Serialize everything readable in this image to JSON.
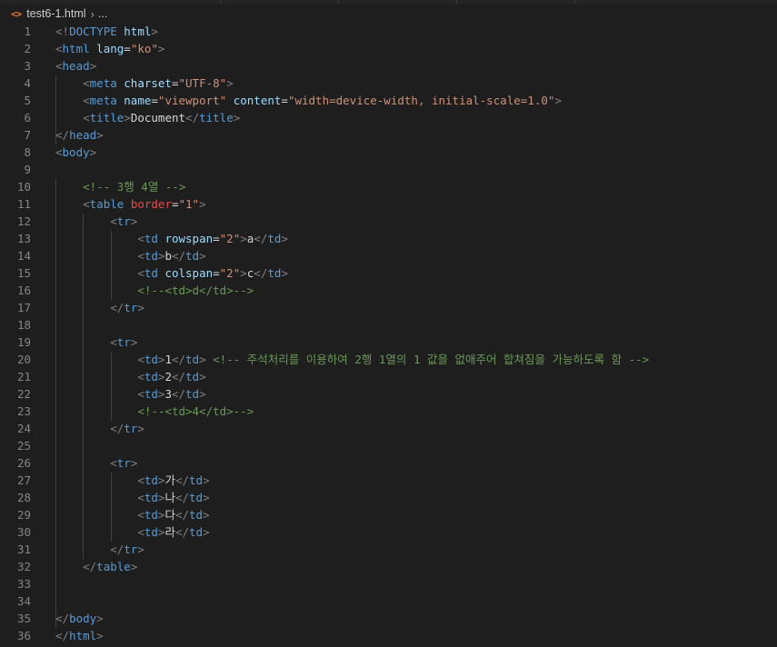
{
  "breadcrumb": {
    "file_icon": "<>",
    "filename": "test6-1.html",
    "ellipsis": "..."
  },
  "lines": [
    {
      "num": "1",
      "tokens": [
        [
          "b",
          "<!"
        ],
        [
          "tag",
          "DOCTYPE"
        ],
        [
          "text",
          " "
        ],
        [
          "attr",
          "html"
        ],
        [
          "b",
          ">"
        ]
      ]
    },
    {
      "num": "2",
      "tokens": [
        [
          "b",
          "<"
        ],
        [
          "tag",
          "html"
        ],
        [
          "text",
          " "
        ],
        [
          "attr",
          "lang"
        ],
        [
          "text",
          "="
        ],
        [
          "str",
          "\"ko\""
        ],
        [
          "b",
          ">"
        ]
      ]
    },
    {
      "num": "3",
      "tokens": [
        [
          "b",
          "<"
        ],
        [
          "tag",
          "head"
        ],
        [
          "b",
          ">"
        ]
      ]
    },
    {
      "num": "4",
      "tokens": [
        [
          "text",
          "    "
        ],
        [
          "b",
          "<"
        ],
        [
          "tag",
          "meta"
        ],
        [
          "text",
          " "
        ],
        [
          "attr",
          "charset"
        ],
        [
          "text",
          "="
        ],
        [
          "str",
          "\"UTF-8\""
        ],
        [
          "b",
          ">"
        ]
      ]
    },
    {
      "num": "5",
      "tokens": [
        [
          "text",
          "    "
        ],
        [
          "b",
          "<"
        ],
        [
          "tag",
          "meta"
        ],
        [
          "text",
          " "
        ],
        [
          "attr",
          "name"
        ],
        [
          "text",
          "="
        ],
        [
          "str",
          "\"viewport\""
        ],
        [
          "text",
          " "
        ],
        [
          "attr",
          "content"
        ],
        [
          "text",
          "="
        ],
        [
          "str",
          "\"width=device-width, initial-scale=1.0\""
        ],
        [
          "b",
          ">"
        ]
      ]
    },
    {
      "num": "6",
      "tokens": [
        [
          "text",
          "    "
        ],
        [
          "b",
          "<"
        ],
        [
          "tag",
          "title"
        ],
        [
          "b",
          ">"
        ],
        [
          "text",
          "Document"
        ],
        [
          "b",
          "</"
        ],
        [
          "tag",
          "title"
        ],
        [
          "b",
          ">"
        ]
      ]
    },
    {
      "num": "7",
      "tokens": [
        [
          "b",
          "</"
        ],
        [
          "tag",
          "head"
        ],
        [
          "b",
          ">"
        ]
      ]
    },
    {
      "num": "8",
      "tokens": [
        [
          "b",
          "<"
        ],
        [
          "tag",
          "body"
        ],
        [
          "b",
          ">"
        ]
      ]
    },
    {
      "num": "9",
      "tokens": []
    },
    {
      "num": "10",
      "tokens": [
        [
          "text",
          "    "
        ],
        [
          "comment",
          "<!-- 3행 4열 -->"
        ]
      ]
    },
    {
      "num": "11",
      "tokens": [
        [
          "text",
          "    "
        ],
        [
          "b",
          "<"
        ],
        [
          "tag",
          "table"
        ],
        [
          "text",
          " "
        ],
        [
          "attrerr",
          "border"
        ],
        [
          "text",
          "="
        ],
        [
          "str",
          "\"1\""
        ],
        [
          "b",
          ">"
        ]
      ]
    },
    {
      "num": "12",
      "tokens": [
        [
          "text",
          "        "
        ],
        [
          "b",
          "<"
        ],
        [
          "tag",
          "tr"
        ],
        [
          "b",
          ">"
        ]
      ]
    },
    {
      "num": "13",
      "tokens": [
        [
          "text",
          "            "
        ],
        [
          "b",
          "<"
        ],
        [
          "tag",
          "td"
        ],
        [
          "text",
          " "
        ],
        [
          "attr",
          "rowspan"
        ],
        [
          "text",
          "="
        ],
        [
          "str",
          "\"2\""
        ],
        [
          "b",
          ">"
        ],
        [
          "text",
          "a"
        ],
        [
          "b",
          "</"
        ],
        [
          "tag",
          "td"
        ],
        [
          "b",
          ">"
        ]
      ]
    },
    {
      "num": "14",
      "tokens": [
        [
          "text",
          "            "
        ],
        [
          "b",
          "<"
        ],
        [
          "tag",
          "td"
        ],
        [
          "b",
          ">"
        ],
        [
          "text",
          "b"
        ],
        [
          "b",
          "</"
        ],
        [
          "tag",
          "td"
        ],
        [
          "b",
          ">"
        ]
      ]
    },
    {
      "num": "15",
      "tokens": [
        [
          "text",
          "            "
        ],
        [
          "b",
          "<"
        ],
        [
          "tag",
          "td"
        ],
        [
          "text",
          " "
        ],
        [
          "attr",
          "colspan"
        ],
        [
          "text",
          "="
        ],
        [
          "str",
          "\"2\""
        ],
        [
          "b",
          ">"
        ],
        [
          "text",
          "c"
        ],
        [
          "b",
          "</"
        ],
        [
          "tag",
          "td"
        ],
        [
          "b",
          ">"
        ]
      ]
    },
    {
      "num": "16",
      "tokens": [
        [
          "text",
          "            "
        ],
        [
          "comment",
          "<!--<td>d</td>-->"
        ]
      ]
    },
    {
      "num": "17",
      "tokens": [
        [
          "text",
          "        "
        ],
        [
          "b",
          "</"
        ],
        [
          "tag",
          "tr"
        ],
        [
          "b",
          ">"
        ]
      ]
    },
    {
      "num": "18",
      "tokens": []
    },
    {
      "num": "19",
      "tokens": [
        [
          "text",
          "        "
        ],
        [
          "b",
          "<"
        ],
        [
          "tag",
          "tr"
        ],
        [
          "b",
          ">"
        ]
      ]
    },
    {
      "num": "20",
      "tokens": [
        [
          "text",
          "            "
        ],
        [
          "b",
          "<"
        ],
        [
          "tag",
          "td"
        ],
        [
          "b",
          ">"
        ],
        [
          "text",
          "1"
        ],
        [
          "b",
          "</"
        ],
        [
          "tag",
          "td"
        ],
        [
          "b",
          ">"
        ],
        [
          "text",
          " "
        ],
        [
          "comment",
          "<!-- 주석처리를 이용하여 2행 1열의 1 값을 없애주어 합쳐짐을 가능하도록 함 -->"
        ]
      ]
    },
    {
      "num": "21",
      "tokens": [
        [
          "text",
          "            "
        ],
        [
          "b",
          "<"
        ],
        [
          "tag",
          "td"
        ],
        [
          "b",
          ">"
        ],
        [
          "text",
          "2"
        ],
        [
          "b",
          "</"
        ],
        [
          "tag",
          "td"
        ],
        [
          "b",
          ">"
        ]
      ]
    },
    {
      "num": "22",
      "tokens": [
        [
          "text",
          "            "
        ],
        [
          "b",
          "<"
        ],
        [
          "tag",
          "td"
        ],
        [
          "b",
          ">"
        ],
        [
          "text",
          "3"
        ],
        [
          "b",
          "</"
        ],
        [
          "tag",
          "td"
        ],
        [
          "b",
          ">"
        ]
      ]
    },
    {
      "num": "23",
      "tokens": [
        [
          "text",
          "            "
        ],
        [
          "comment",
          "<!--<td>4</td>-->"
        ]
      ]
    },
    {
      "num": "24",
      "tokens": [
        [
          "text",
          "        "
        ],
        [
          "b",
          "</"
        ],
        [
          "tag",
          "tr"
        ],
        [
          "b",
          ">"
        ]
      ]
    },
    {
      "num": "25",
      "tokens": []
    },
    {
      "num": "26",
      "tokens": [
        [
          "text",
          "        "
        ],
        [
          "b",
          "<"
        ],
        [
          "tag",
          "tr"
        ],
        [
          "b",
          ">"
        ]
      ]
    },
    {
      "num": "27",
      "tokens": [
        [
          "text",
          "            "
        ],
        [
          "b",
          "<"
        ],
        [
          "tag",
          "td"
        ],
        [
          "b",
          ">"
        ],
        [
          "text",
          "가"
        ],
        [
          "b",
          "</"
        ],
        [
          "tag",
          "td"
        ],
        [
          "b",
          ">"
        ]
      ]
    },
    {
      "num": "28",
      "tokens": [
        [
          "text",
          "            "
        ],
        [
          "b",
          "<"
        ],
        [
          "tag",
          "td"
        ],
        [
          "b",
          ">"
        ],
        [
          "text",
          "나"
        ],
        [
          "b",
          "</"
        ],
        [
          "tag",
          "td"
        ],
        [
          "b",
          ">"
        ]
      ]
    },
    {
      "num": "29",
      "tokens": [
        [
          "text",
          "            "
        ],
        [
          "b",
          "<"
        ],
        [
          "tag",
          "td"
        ],
        [
          "b",
          ">"
        ],
        [
          "text",
          "다"
        ],
        [
          "b",
          "</"
        ],
        [
          "tag",
          "td"
        ],
        [
          "b",
          ">"
        ]
      ]
    },
    {
      "num": "30",
      "tokens": [
        [
          "text",
          "            "
        ],
        [
          "b",
          "<"
        ],
        [
          "tag",
          "td"
        ],
        [
          "b",
          ">"
        ],
        [
          "text",
          "라"
        ],
        [
          "b",
          "</"
        ],
        [
          "tag",
          "td"
        ],
        [
          "b",
          ">"
        ]
      ]
    },
    {
      "num": "31",
      "tokens": [
        [
          "text",
          "        "
        ],
        [
          "b",
          "</"
        ],
        [
          "tag",
          "tr"
        ],
        [
          "b",
          ">"
        ]
      ]
    },
    {
      "num": "32",
      "tokens": [
        [
          "text",
          "    "
        ],
        [
          "b",
          "</"
        ],
        [
          "tag",
          "table"
        ],
        [
          "b",
          ">"
        ]
      ]
    },
    {
      "num": "33",
      "tokens": []
    },
    {
      "num": "34",
      "tokens": []
    },
    {
      "num": "35",
      "tokens": [
        [
          "b",
          "</"
        ],
        [
          "tag",
          "body"
        ],
        [
          "b",
          ">"
        ]
      ]
    },
    {
      "num": "36",
      "tokens": [
        [
          "b",
          "</"
        ],
        [
          "tag",
          "html"
        ],
        [
          "b",
          ">"
        ]
      ]
    }
  ]
}
